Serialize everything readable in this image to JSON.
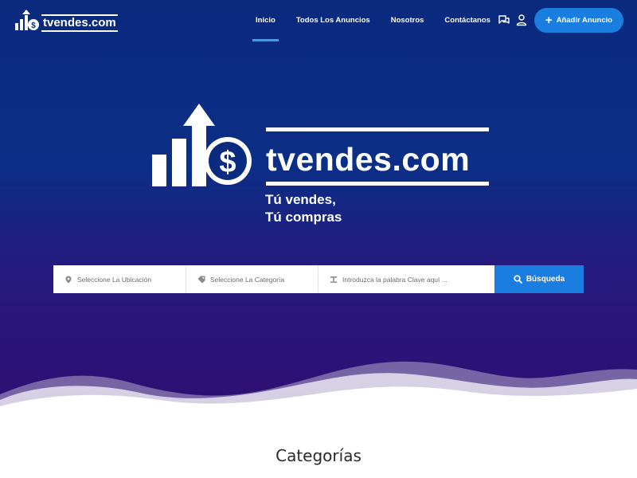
{
  "brand": {
    "name": "tvendes.com"
  },
  "nav": {
    "items": [
      {
        "label": "Inicio",
        "active": true
      },
      {
        "label": "Todos Los Anuncios",
        "active": false
      },
      {
        "label": "Nosotros",
        "active": false
      },
      {
        "label": "Contáctanos",
        "active": false
      }
    ],
    "add_button_label": "Añadir Anuncio",
    "icons": [
      "chat-icon",
      "user-icon",
      "plus-icon"
    ]
  },
  "hero": {
    "logo_name": "tvendes.com",
    "tagline_line1": "Tú vendes,",
    "tagline_line2": "Tú compras"
  },
  "search": {
    "location_placeholder": "Seleccione La Ubicación",
    "category_placeholder": "Seleccione La Categoría",
    "keyword_placeholder": "Introduzca la palabra Clave aquí ...",
    "button_label": "Búsqueda",
    "icons": [
      "map-pin-icon",
      "tag-icon",
      "keyword-icon",
      "search-icon"
    ]
  },
  "categories": {
    "title": "Categorías"
  },
  "colors": {
    "hero_top": "#0a2a7e",
    "hero_bottom": "#2f0f73",
    "accent": "#1a7ee0",
    "nav_active": "#2fa2f0"
  }
}
